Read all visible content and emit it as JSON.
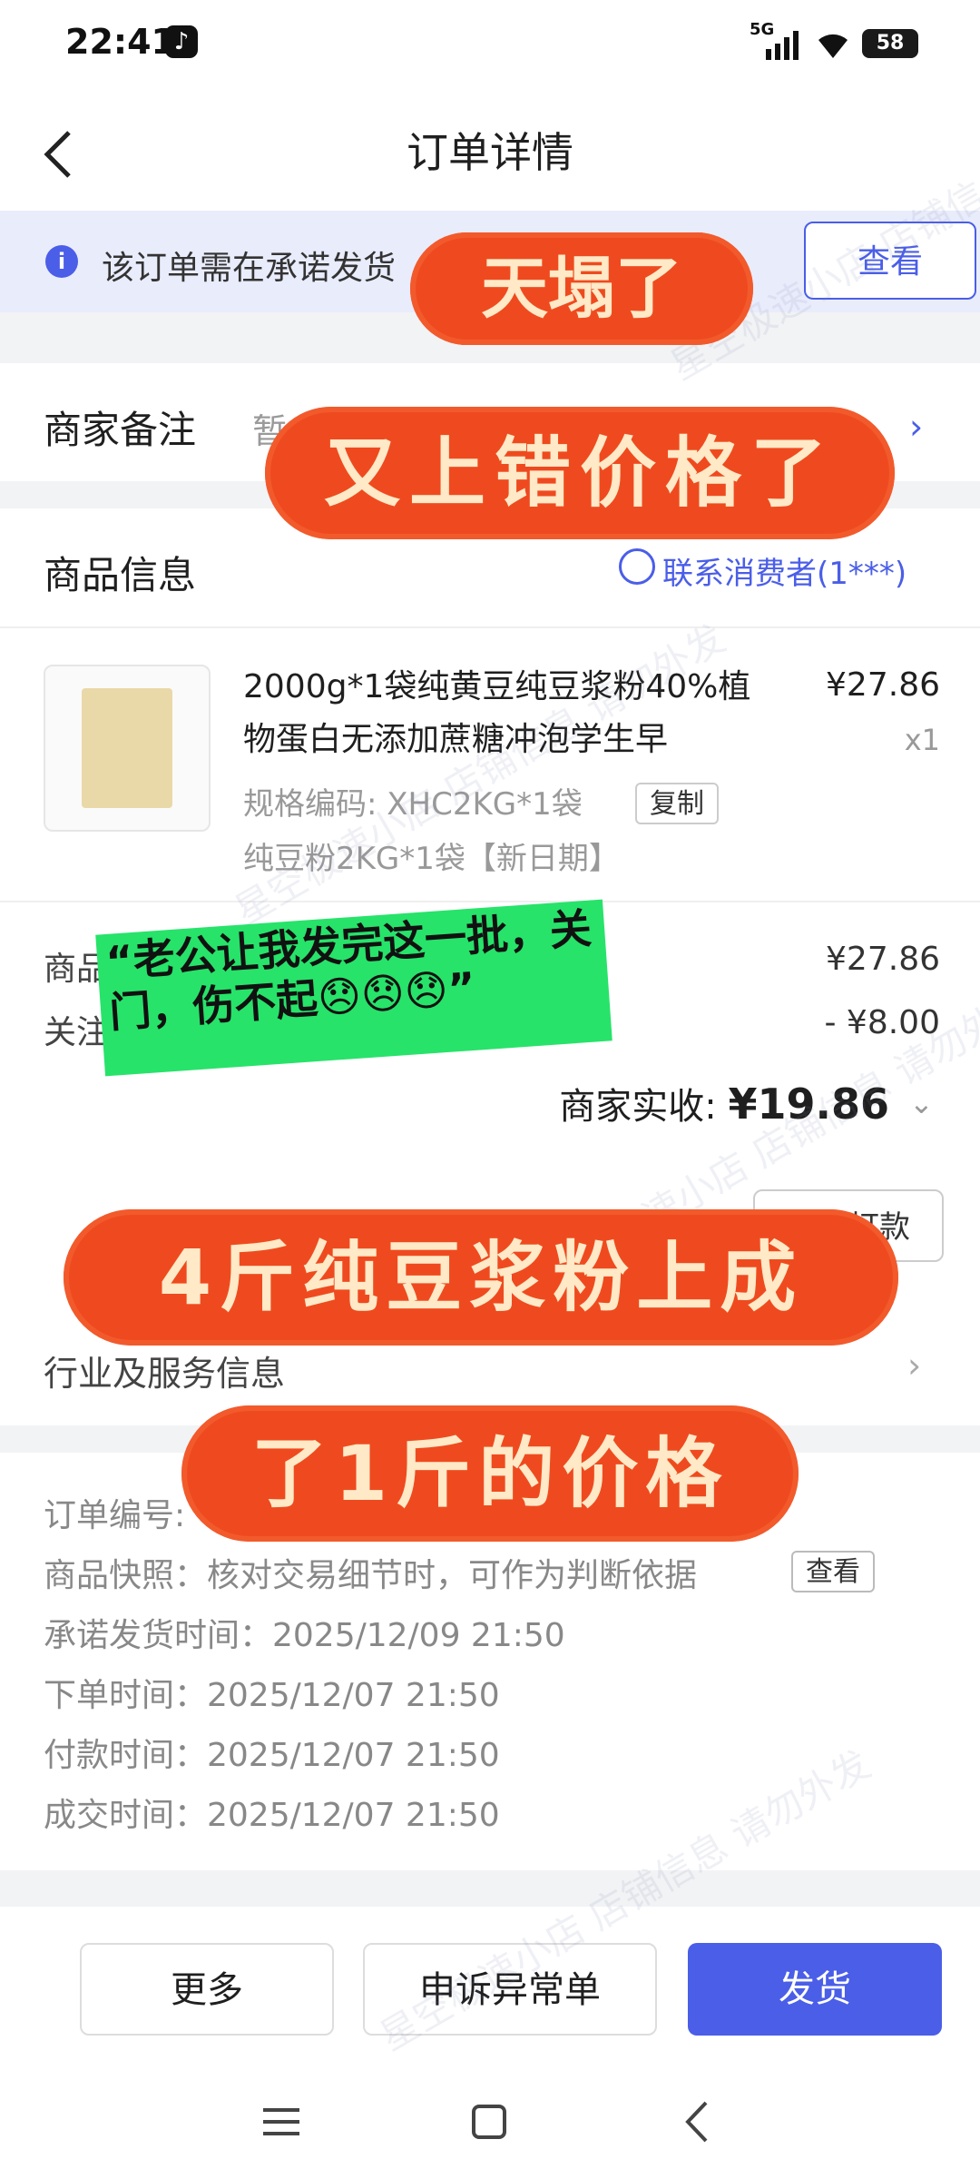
{
  "status_bar": {
    "time": "22:41",
    "network": "5G",
    "battery": "58"
  },
  "header": {
    "title": "订单详情"
  },
  "notice": {
    "text": "该订单需在承诺发货",
    "button": "查看"
  },
  "merchant_note": {
    "label": "商家备注",
    "value": "暂"
  },
  "goods": {
    "title": "商品信息",
    "contact": "联系消费者(1***)",
    "product_name": "2000g*1袋纯黄豆纯豆浆粉40%植物蛋白无添加蔗糖冲泡学生早",
    "price": "¥27.86",
    "qty": "x1",
    "spec": "规格编码: XHC2KG*1袋",
    "copy": "复制",
    "variant": "纯豆粉2KG*1袋【新日期】",
    "row1_label": "商品",
    "row1_value": "¥27.86",
    "row2_label": "关注",
    "row2_value": "- ¥8.00",
    "received_label": "商家实收:",
    "received_value": "¥19.86",
    "partial_button": "上海打款"
  },
  "industry": {
    "label": "行业及服务信息"
  },
  "order_info": {
    "order_no_label": "订单编号:",
    "snapshot": "商品快照：核对交易细节时，可作为判断依据",
    "snapshot_button": "查看",
    "promise_time": "承诺发货时间：2025/12/09 21:50",
    "order_time": "下单时间：2025/12/07 21:50",
    "pay_time": "付款时间：2025/12/07 21:50",
    "deal_time": "成交时间：2025/12/07 21:50"
  },
  "bottom": {
    "more": "更多",
    "appeal": "申诉异常单",
    "ship": "发货"
  },
  "overlays": {
    "pill1": "天塌了",
    "pill2": "又上错价格了",
    "note": "“老公让我发完这一批，关门，伤不起😞😞😞”",
    "pill3": "4斤纯豆浆粉上成",
    "pill4": "了1斤的价格"
  },
  "watermark": "星空极速小店 店铺信息 请勿外发",
  "colors": {
    "accent": "#4a5ee8",
    "pill": "#ef4a1f",
    "note": "#27e36a"
  }
}
